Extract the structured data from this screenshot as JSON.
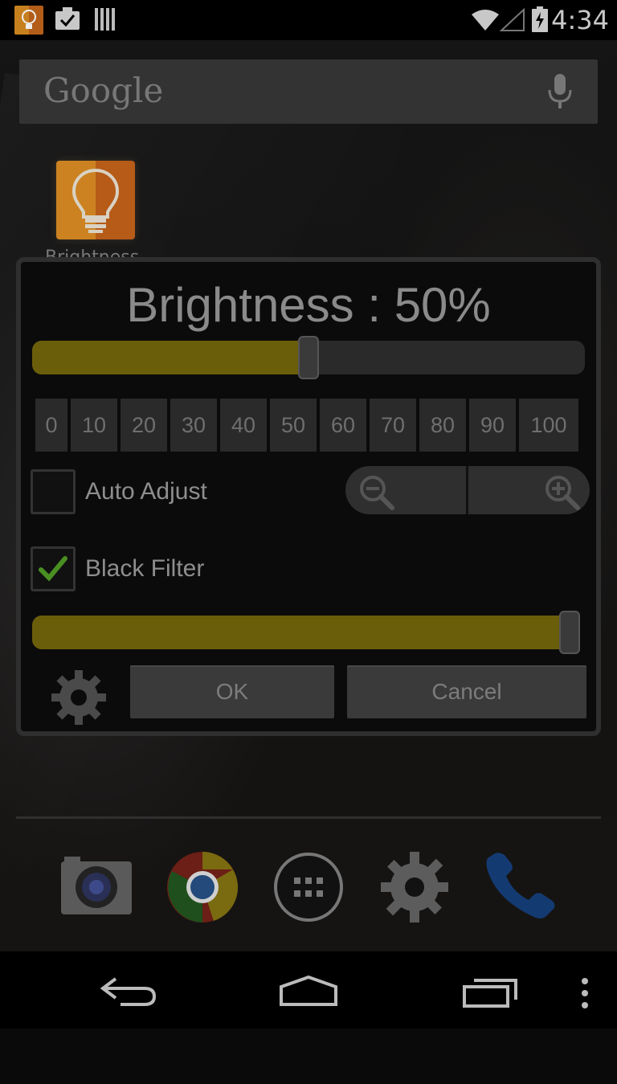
{
  "status_bar": {
    "time": "4:34",
    "icons": [
      "app-notification-icon",
      "checklist-icon",
      "barcode-icon",
      "wifi-icon",
      "signal-icon",
      "battery-charging-icon"
    ]
  },
  "search": {
    "logo": "Google",
    "icon": "mic-icon"
  },
  "home": {
    "app_label": "Brightness"
  },
  "dialog": {
    "title": "Brightness : 50%",
    "brightness_percent": 50,
    "quick_levels": [
      "0",
      "10",
      "20",
      "30",
      "40",
      "50",
      "60",
      "70",
      "80",
      "90",
      "100"
    ],
    "auto_adjust": {
      "label": "Auto Adjust",
      "checked": false
    },
    "black_filter": {
      "label": "Black Filter",
      "checked": true
    },
    "filter_level_percent": 100,
    "zoom_icons": [
      "zoom-out-icon",
      "zoom-in-icon"
    ],
    "ok_label": "OK",
    "cancel_label": "Cancel"
  },
  "dock": {
    "icons": [
      "camera-icon",
      "chrome-icon",
      "app-drawer-icon",
      "settings-icon",
      "phone-icon"
    ]
  },
  "nav_bar": {
    "icons": [
      "back-icon",
      "home-icon",
      "recents-icon",
      "menu-icon"
    ]
  },
  "colors": {
    "slider_fill": "#6b5e0b",
    "check_green": "#4a8f22"
  }
}
